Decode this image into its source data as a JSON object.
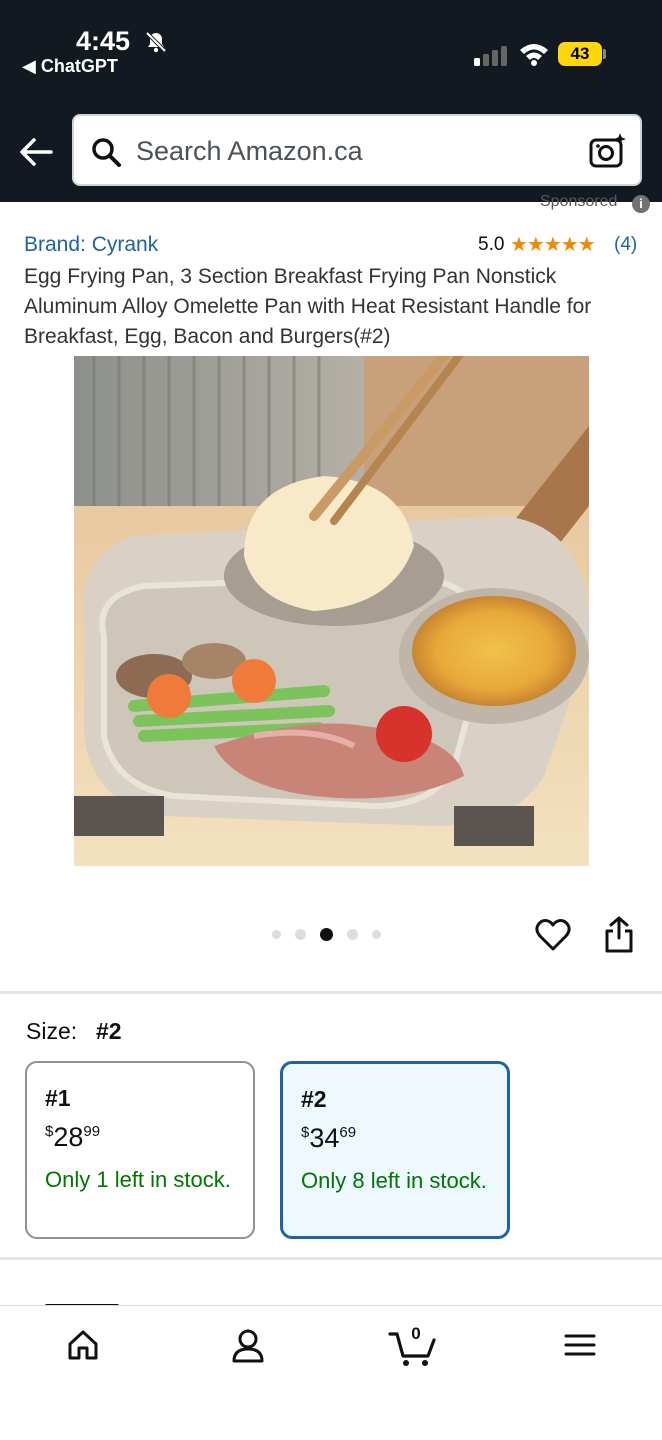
{
  "status_bar": {
    "time": "4:45",
    "back_app": "◀ ChatGPT",
    "battery": "43"
  },
  "search": {
    "placeholder": "Search Amazon.ca"
  },
  "sponsored": {
    "label": "Sponsored",
    "info": "i"
  },
  "product": {
    "brand": "Brand: Cyrank",
    "rating": "5.0",
    "stars": "★★★★★",
    "review_count": "(4)",
    "title": "Egg Frying Pan, 3 Section Breakfast Frying Pan Nonstick Aluminum Alloy Omelette Pan with Heat Resistant Handle for Breakfast, Egg, Bacon and Burgers(#2)",
    "image_icon": "product-photo-frying-pan",
    "carousel": {
      "total": 5,
      "active_index": 3
    }
  },
  "size_selector": {
    "label": "Size:",
    "selected": "#2",
    "options": [
      {
        "name": "#1",
        "currency": "$",
        "dollars": "28",
        "cents": "99",
        "stock": "Only 1 left in stock."
      },
      {
        "name": "#2",
        "currency": "$",
        "dollars": "34",
        "cents": "69",
        "stock": "Only 8 left in stock."
      }
    ]
  },
  "tabbar": {
    "cart_count": "0",
    "icons": [
      "home-icon",
      "account-icon",
      "cart-icon",
      "menu-icon"
    ]
  },
  "colors": {
    "header_bg": "#131921",
    "link": "#2162a1",
    "star": "#f08804",
    "stock_green": "#007600",
    "selected_border": "#2162a1",
    "selected_bg": "#edf8ff"
  }
}
